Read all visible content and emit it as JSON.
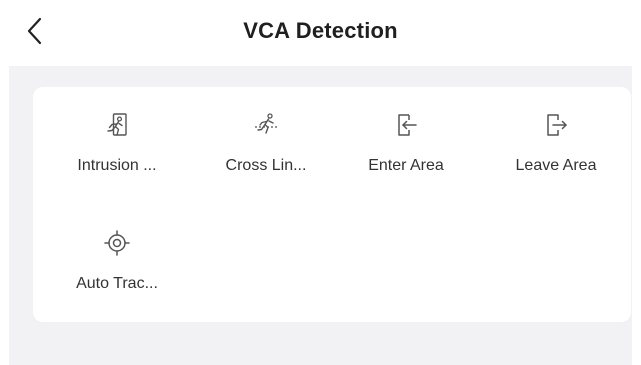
{
  "header": {
    "title": "VCA Detection"
  },
  "features": [
    {
      "label": "Intrusion ...",
      "icon": "intrusion-icon"
    },
    {
      "label": "Cross Lin...",
      "icon": "line-crossing-icon"
    },
    {
      "label": "Enter Area",
      "icon": "enter-area-icon"
    },
    {
      "label": "Leave Area",
      "icon": "leave-area-icon"
    },
    {
      "label": "Auto Trac...",
      "icon": "target-icon"
    }
  ],
  "colors": {
    "background": "#f2f2f4",
    "card": "#ffffff",
    "text": "#333333",
    "icon": "#555555"
  }
}
